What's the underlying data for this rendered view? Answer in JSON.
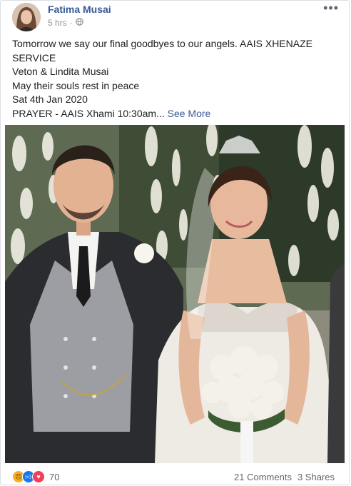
{
  "post": {
    "author": "Fatima Musai",
    "time": "5 hrs",
    "dot": "·",
    "privacy_icon": "globe-icon",
    "more_icon": "more-options-icon",
    "lines": [
      "Tomorrow we say our final goodbyes to our angels. AAIS XHENAZE",
      "SERVICE",
      "Veton & Lindita Musai",
      "May their souls rest in peace",
      "Sat 4th Jan 2020",
      "PRAYER - AAIS Xhami 10:30am..."
    ],
    "see_more": "See More"
  },
  "footer": {
    "reaction_icons": [
      "sad-reaction-icon",
      "like-reaction-icon",
      "love-reaction-icon"
    ],
    "reaction_count": "70",
    "comments": "21 Comments",
    "shares": "3 Shares"
  },
  "colors": {
    "name": "#385898",
    "muted": "#90949c",
    "like": "#1877f2",
    "love": "#f33e58",
    "sad": "#f7b125"
  }
}
